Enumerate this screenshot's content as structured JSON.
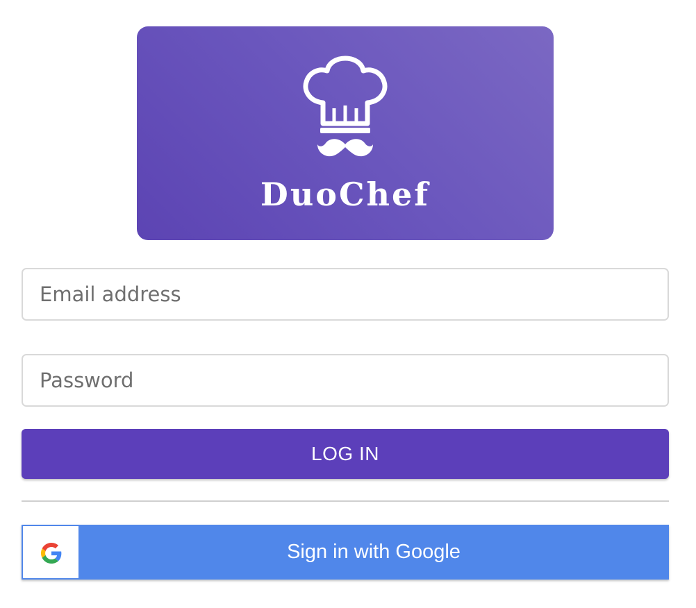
{
  "brand": {
    "name": "DuoChef",
    "logo_icon": "chef-hat-mustache-icon",
    "card_color": "#6a56bd"
  },
  "form": {
    "email_placeholder": "Email address",
    "password_placeholder": "Password",
    "login_label": "LOG IN",
    "login_color": "#5c3fba"
  },
  "google": {
    "label": "Sign in with Google",
    "icon": "google-g-icon",
    "color": "#5087ea"
  }
}
